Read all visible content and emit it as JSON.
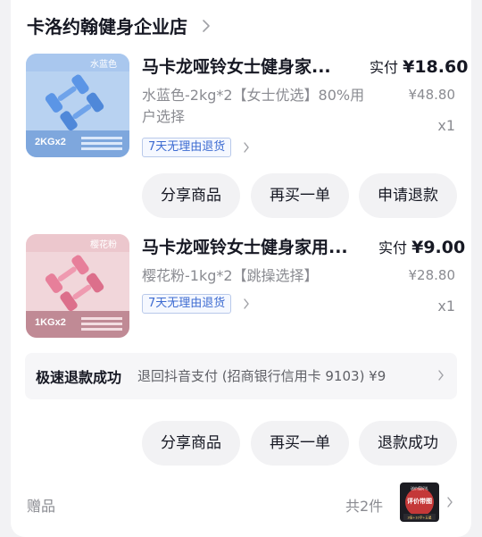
{
  "store": {
    "name": "卡洛约翰健身企业店",
    "chevron_icon": "chevron-right-icon"
  },
  "items": [
    {
      "title": "马卡龙哑铃女士健身家...",
      "spec": "水蓝色-2kg*2【女士优选】80%用户选择",
      "pay_label": "实付",
      "pay_price": "¥18.60",
      "original_price": "¥48.80",
      "qty": "x1",
      "tag": "7天无理由退货",
      "thumb_corner_label": "水蓝色",
      "thumb_weight_label": "2KGx2",
      "thumb_color": "#a9c7ee",
      "dumbbell_color": "#5b95e6"
    },
    {
      "title": "马卡龙哑铃女士健身家用...",
      "spec": "樱花粉-1kg*2【跳操选择】",
      "pay_label": "实付",
      "pay_price": "¥9.00",
      "original_price": "¥28.80",
      "qty": "x1",
      "tag": "7天无理由退货",
      "thumb_corner_label": "樱花粉",
      "thumb_weight_label": "1KGx2",
      "thumb_color": "#ecc7cd",
      "dumbbell_color": "#e77f9a"
    }
  ],
  "actions_1": {
    "share": "分享商品",
    "rebuy": "再买一单",
    "refund": "申请退款"
  },
  "refund_status": {
    "title": "极速退款成功",
    "detail": "退回抖音支付 (招商银行信用卡 9103) ¥9"
  },
  "actions_2": {
    "share": "分享商品",
    "rebuy": "再买一单",
    "refund_done": "退款成功"
  },
  "gift": {
    "label": "赠品",
    "count": "共2件",
    "thumb_top_text": "送价值好礼",
    "thumb_mid_text": "评价带图",
    "thumb_bottom_text": "3倍+10字+五星"
  },
  "colors": {
    "accent_blue": "#3d6bd1",
    "text_primary": "#161823",
    "text_secondary": "#8a8b91"
  }
}
